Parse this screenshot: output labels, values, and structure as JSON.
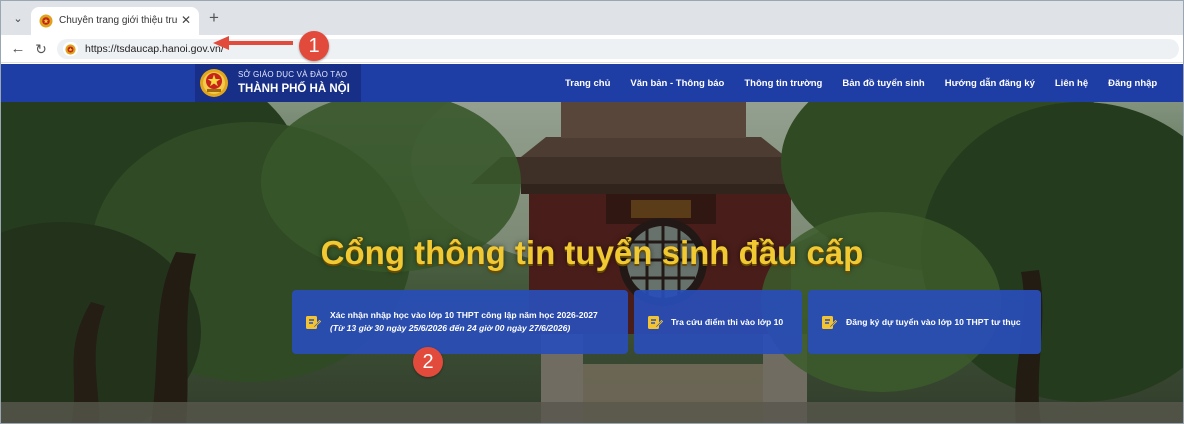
{
  "browser": {
    "tab": {
      "title": "Chuyên trang giới thiệu trường tuyển sinh"
    },
    "address": {
      "url": "https://tsdaucap.hanoi.gov.vn/"
    }
  },
  "site": {
    "org": {
      "line1": "SỞ GIÁO DỤC VÀ ĐÀO TẠO",
      "line2": "THÀNH PHỐ HÀ NỘI"
    },
    "nav": [
      {
        "label": "Trang chủ"
      },
      {
        "label": "Văn bản - Thông báo"
      },
      {
        "label": "Thông tin trường"
      },
      {
        "label": "Bản đồ tuyển sinh"
      },
      {
        "label": "Hướng dẫn đăng ký"
      },
      {
        "label": "Liên hệ"
      },
      {
        "label": "Đăng nhập"
      }
    ],
    "hero_title": "Cổng thông tin tuyển sinh đầu cấp",
    "cards": [
      {
        "title": "Xác nhận nhập học vào lớp 10 THPT công lập năm học 2026-2027",
        "subtitle": "(Từ 13 giờ 30 ngày 25/6/2026 đến 24 giờ 00 ngày 27/6/2026)"
      },
      {
        "title": "Tra cứu điểm thi vào lớp 10"
      },
      {
        "title": "Đăng ký dự tuyển vào lớp 10 THPT tư thục"
      }
    ]
  },
  "annotations": [
    {
      "label": "1"
    },
    {
      "label": "2"
    }
  ],
  "icons": {
    "tab_list": "chevron-down-icon",
    "favicon": "site-emblem-icon",
    "close": "close-icon",
    "new_tab": "plus-icon",
    "back": "back-arrow-icon",
    "reload": "reload-icon",
    "card": "edit-document-icon"
  },
  "colors": {
    "header_blue": "#1e3da5",
    "logo_block": "#172f86",
    "card_blue": "#294eb8",
    "hero_title_gold": "#f1c933",
    "marker_red": "#e24b3c",
    "card_icon_yellow": "#f4c430"
  }
}
